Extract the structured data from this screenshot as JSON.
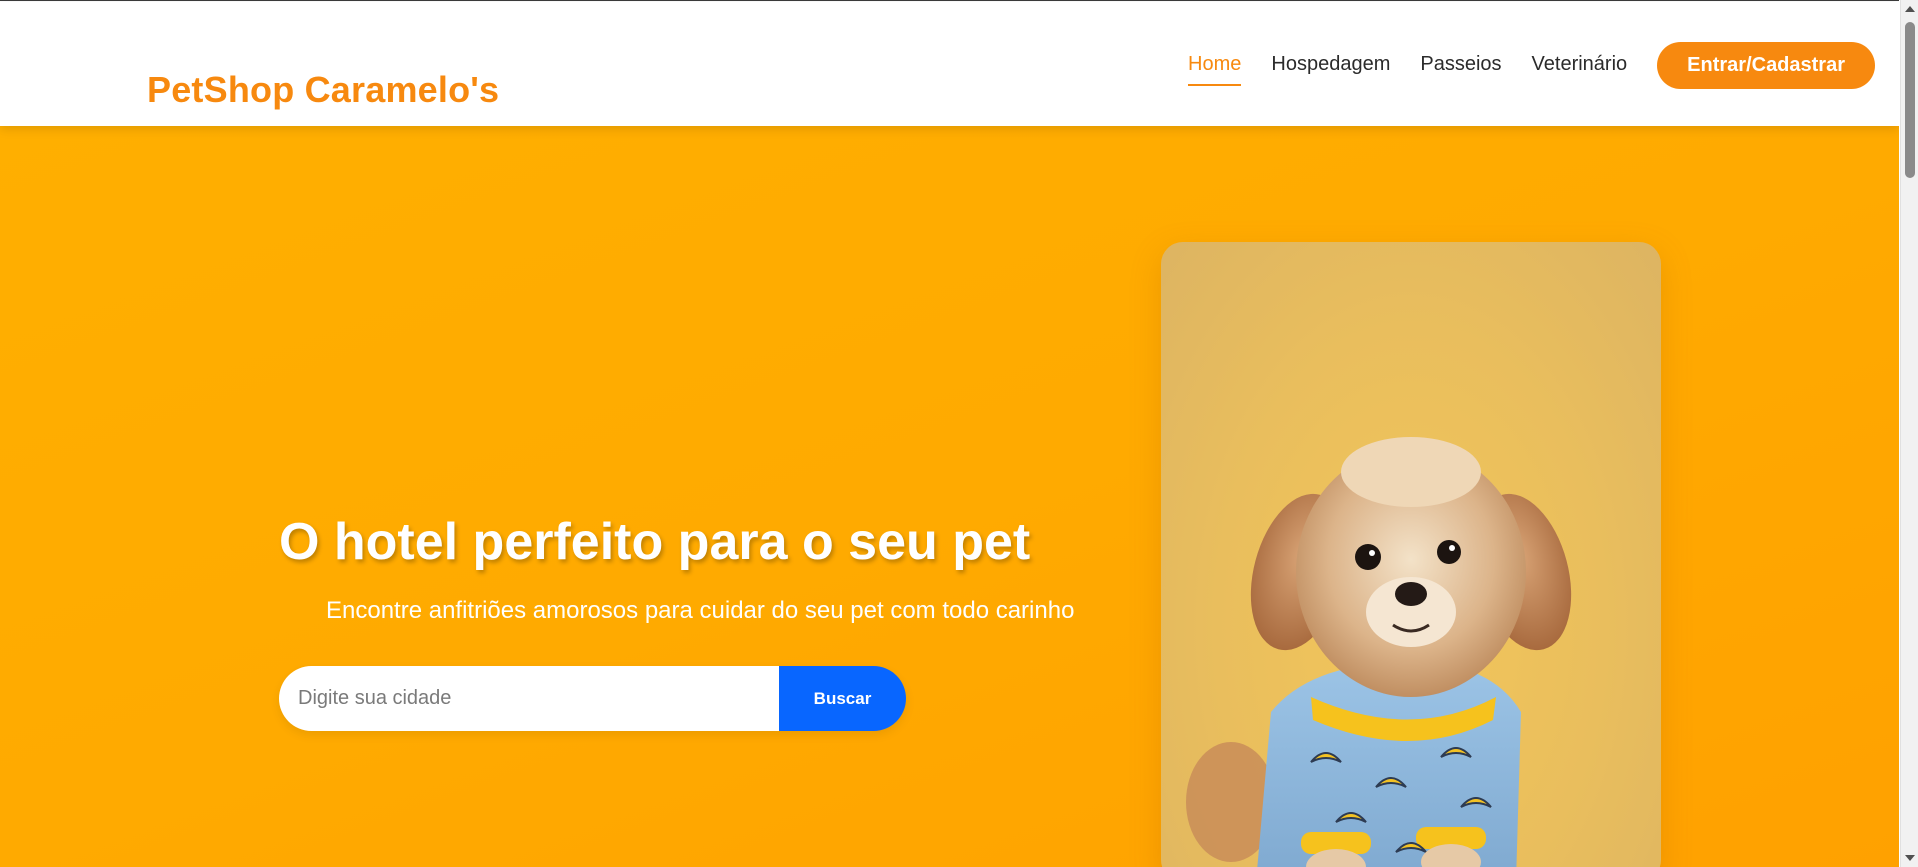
{
  "header": {
    "logo": "PetShop Caramelo's",
    "nav": [
      {
        "label": "Home",
        "active": true
      },
      {
        "label": "Hospedagem",
        "active": false
      },
      {
        "label": "Passeios",
        "active": false
      },
      {
        "label": "Veterinário",
        "active": false
      }
    ],
    "login_label": "Entrar/Cadastrar"
  },
  "hero": {
    "title": "O hotel perfeito para o seu pet",
    "subtitle": "Encontre anfitriões amorosos para cuidar do seu pet com todo carinho",
    "search": {
      "placeholder": "Digite sua cidade",
      "button_label": "Buscar"
    },
    "photo_subject": "puppy-in-banana-pajamas-photo"
  },
  "colors": {
    "brand": "#f7890f",
    "hero_bg": "#ffaa00",
    "search_button": "#0866ff",
    "text_dark": "#2b2b2b",
    "white": "#ffffff"
  }
}
